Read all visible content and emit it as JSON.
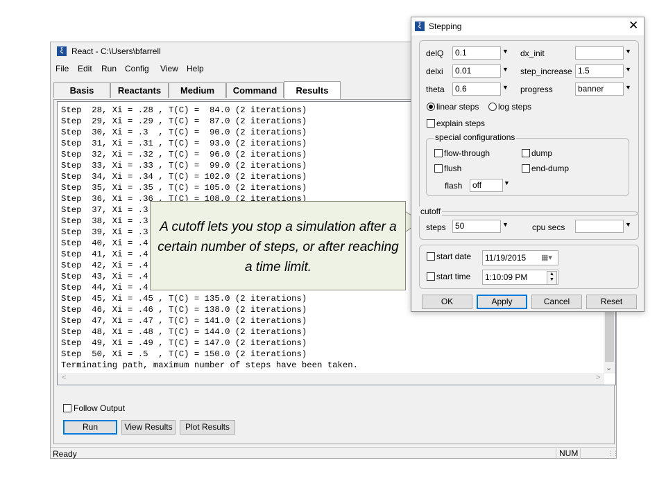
{
  "react_window": {
    "title": "React - C:\\Users\\bfarrell",
    "icon": "xi-app-icon",
    "menu": [
      "File",
      "Edit",
      "Run",
      "Config",
      "View",
      "Help"
    ],
    "tabs": [
      "Basis",
      "Reactants",
      "Medium",
      "Command",
      "Results"
    ],
    "active_tab": "Results",
    "output_lines": [
      "Step  28, Xi = .28 , T(C) =  84.0 (2 iterations)",
      "Step  29, Xi = .29 , T(C) =  87.0 (2 iterations)",
      "Step  30, Xi = .3  , T(C) =  90.0 (2 iterations)",
      "Step  31, Xi = .31 , T(C) =  93.0 (2 iterations)",
      "Step  32, Xi = .32 , T(C) =  96.0 (2 iterations)",
      "Step  33, Xi = .33 , T(C) =  99.0 (2 iterations)",
      "Step  34, Xi = .34 , T(C) = 102.0 (2 iterations)",
      "Step  35, Xi = .35 , T(C) = 105.0 (2 iterations)",
      "Step  36, Xi = .36 , T(C) = 108.0 (2 iterations)",
      "Step  37, Xi = .3",
      "Step  38, Xi = .3",
      "Step  39, Xi = .3",
      "Step  40, Xi = .4",
      "Step  41, Xi = .4",
      "Step  42, Xi = .4",
      "Step  43, Xi = .4",
      "Step  44, Xi = .4",
      "Step  45, Xi = .45 , T(C) = 135.0 (2 iterations)",
      "Step  46, Xi = .46 , T(C) = 138.0 (2 iterations)",
      "Step  47, Xi = .47 , T(C) = 141.0 (2 iterations)",
      "Step  48, Xi = .48 , T(C) = 144.0 (2 iterations)",
      "Step  49, Xi = .49 , T(C) = 147.0 (2 iterations)",
      "Step  50, Xi = .5  , T(C) = 150.0 (2 iterations)",
      "Terminating path, maximum number of steps have been taken."
    ],
    "follow_output_label": "Follow Output",
    "buttons": {
      "run": "Run",
      "view_results": "View Results",
      "plot_results": "Plot Results"
    },
    "status": {
      "text": "Ready",
      "num": "NUM"
    }
  },
  "callout": {
    "text": "A cutoff lets you stop a simulation after a certain number of steps, or after reaching a time limit."
  },
  "stepping_dialog": {
    "title": "Stepping",
    "icon": "xi-app-icon",
    "fields": {
      "delQ": {
        "label": "delQ",
        "value": "0.1"
      },
      "delxi": {
        "label": "delxi",
        "value": "0.01"
      },
      "theta": {
        "label": "theta",
        "value": "0.6"
      },
      "dx_init": {
        "label": "dx_init",
        "value": ""
      },
      "step_increase": {
        "label": "step_increase",
        "value": "1.5"
      },
      "progress": {
        "label": "progress",
        "value": "banner"
      }
    },
    "linear_steps": "linear steps",
    "log_steps": "log steps",
    "explain_steps": "explain steps",
    "special_configurations": {
      "legend": "special configurations",
      "flow_through": "flow-through",
      "dump": "dump",
      "flush": "flush",
      "end_dump": "end-dump",
      "flash_label": "flash",
      "flash_value": "off"
    },
    "cutoff": {
      "legend": "cutoff",
      "steps_label": "steps",
      "steps_value": "50",
      "cpu_secs_label": "cpu secs",
      "cpu_secs_value": ""
    },
    "start_date_label": "start date",
    "start_date_value": "11/19/2015",
    "start_time_label": "start time",
    "start_time_value": "1:10:09 PM",
    "buttons": {
      "ok": "OK",
      "apply": "Apply",
      "cancel": "Cancel",
      "reset": "Reset"
    }
  }
}
